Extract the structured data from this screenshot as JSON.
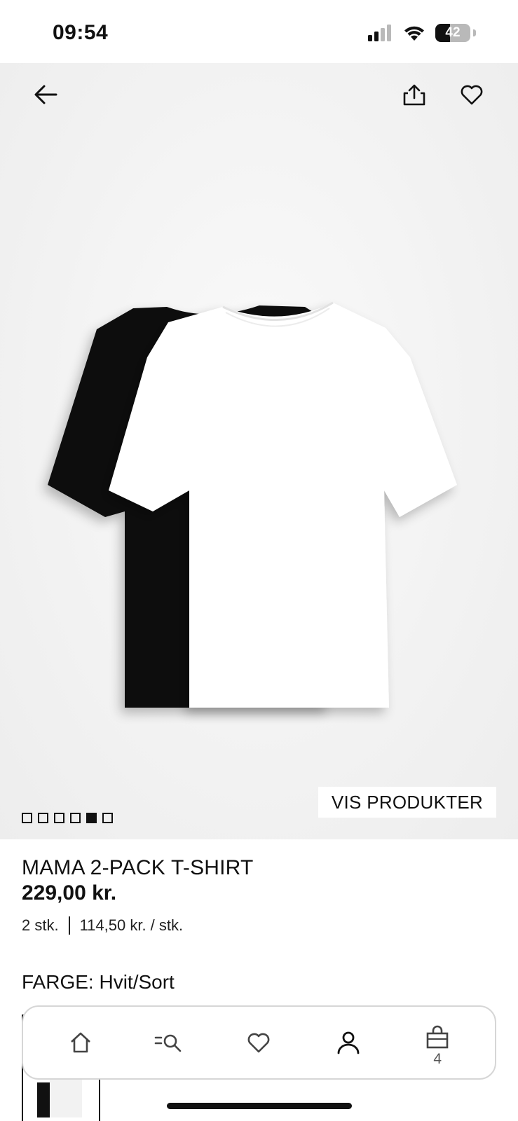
{
  "status_bar": {
    "time": "09:54",
    "battery_percent": 42,
    "battery_label": "42",
    "icons": [
      "signal-icon",
      "wifi-icon",
      "battery-icon"
    ]
  },
  "header": {
    "icons": [
      "back-arrow-icon",
      "share-icon",
      "heart-icon"
    ]
  },
  "hero": {
    "vis_produkter_label": "VIS PRODUKTER",
    "image_count": 6,
    "active_image_index": 4
  },
  "product": {
    "name": "MAMA 2-PACK T-SHIRT",
    "price": "229,00 kr.",
    "quantity": "2 stk.",
    "unit_price": "114,50 kr. / stk.",
    "color_label": "FARGE: Hvit/Sort"
  },
  "bottom_nav": {
    "items": [
      {
        "name": "home",
        "icon": "home-icon"
      },
      {
        "name": "search",
        "icon": "search-menu-icon"
      },
      {
        "name": "favorites",
        "icon": "heart-icon"
      },
      {
        "name": "account",
        "icon": "person-icon"
      },
      {
        "name": "cart",
        "icon": "shopping-bag-icon"
      }
    ],
    "cart_count": "4"
  },
  "colors": {
    "text": "#111111",
    "hero_bg": "#f4f4f4",
    "nav_border": "#d6d6d6"
  }
}
